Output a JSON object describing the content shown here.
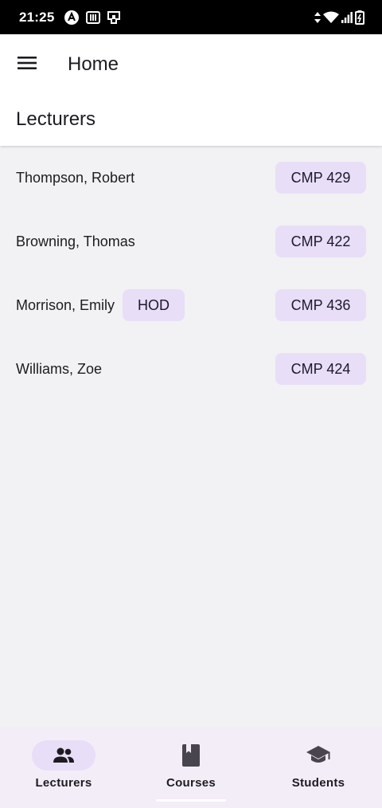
{
  "status_bar": {
    "time": "21:25",
    "left_icons": [
      "app-a-icon",
      "nfc-icon",
      "sim-icon"
    ],
    "right_icons": [
      "data-arrows-icon",
      "wifi-icon",
      "signal-icon",
      "battery-icon"
    ]
  },
  "appbar": {
    "menu_icon": "hamburger-menu-icon",
    "title": "Home",
    "section_title": "Lecturers"
  },
  "lecturers": [
    {
      "name": "Thompson, Robert",
      "badge": "",
      "course": "CMP 429"
    },
    {
      "name": "Browning, Thomas",
      "badge": "",
      "course": "CMP 422"
    },
    {
      "name": "Morrison, Emily",
      "badge": "HOD",
      "course": "CMP 436"
    },
    {
      "name": "Williams, Zoe",
      "badge": "",
      "course": "CMP 424"
    }
  ],
  "bottom_nav": {
    "items": [
      {
        "label": "Lecturers",
        "icon": "people-icon",
        "active": true
      },
      {
        "label": "Courses",
        "icon": "book-icon",
        "active": false
      },
      {
        "label": "Students",
        "icon": "graduation-cap-icon",
        "active": false
      }
    ]
  },
  "colors": {
    "chip_background": "#e8def8",
    "nav_background": "#f3edf7",
    "page_background": "#f2f1f3"
  }
}
